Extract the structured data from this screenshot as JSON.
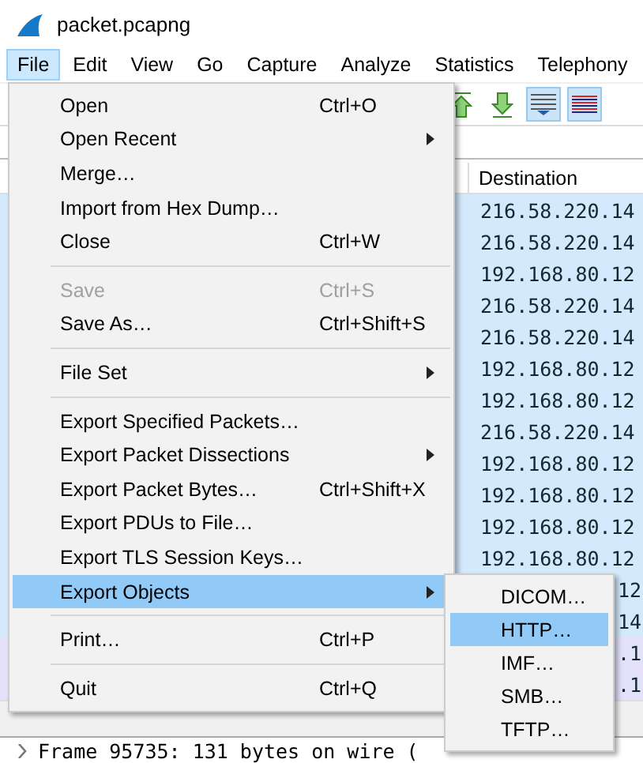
{
  "window": {
    "title": "packet.pcapng"
  },
  "menubar": [
    {
      "label": "File",
      "selected": true
    },
    {
      "label": "Edit",
      "selected": false
    },
    {
      "label": "View",
      "selected": false
    },
    {
      "label": "Go",
      "selected": false
    },
    {
      "label": "Capture",
      "selected": false
    },
    {
      "label": "Analyze",
      "selected": false
    },
    {
      "label": "Statistics",
      "selected": false
    },
    {
      "label": "Telephony",
      "selected": false
    }
  ],
  "toolbar": [
    {
      "kind": "go-first",
      "pressed": false
    },
    {
      "kind": "go-last",
      "pressed": false
    },
    {
      "kind": "autoscroll",
      "pressed": true
    },
    {
      "kind": "colorize",
      "pressed": true
    }
  ],
  "packet_list": {
    "columns": [
      "Destination"
    ],
    "rows": [
      {
        "destination": "216.58.220.14",
        "color": "#d4e9fc"
      },
      {
        "destination": "216.58.220.14",
        "color": "#d4e9fc"
      },
      {
        "destination": "192.168.80.12",
        "color": "#d4e9fc"
      },
      {
        "destination": "216.58.220.14",
        "color": "#d4e9fc"
      },
      {
        "destination": "216.58.220.14",
        "color": "#d4e9fc"
      },
      {
        "destination": "192.168.80.12",
        "color": "#d4e9fc"
      },
      {
        "destination": "192.168.80.12",
        "color": "#d4e9fc"
      },
      {
        "destination": "216.58.220.14",
        "color": "#d4e9fc"
      },
      {
        "destination": "192.168.80.12",
        "color": "#d4e9fc"
      },
      {
        "destination": "192.168.80.12",
        "color": "#d4e9fc"
      },
      {
        "destination": "192.168.80.12",
        "color": "#d4e9fc"
      },
      {
        "destination": "192.168.80.12",
        "color": "#d4e9fc"
      },
      {
        "kind": "covered",
        "destination": "12",
        "color": "#d4e9fc"
      },
      {
        "kind": "covered",
        "destination": "14",
        "color": "#d4e9fc"
      },
      {
        "kind": "covered",
        "destination": ".1",
        "color": "#e4e2fa"
      },
      {
        "kind": "covered",
        "destination": ".1",
        "color": "#e4e2fa"
      }
    ]
  },
  "packet_details": [
    {
      "text": "Frame 95735: 131 bytes on wire (",
      "expanded": false
    }
  ],
  "file_menu": [
    {
      "kind": "item",
      "label": "Open",
      "shortcut": "Ctrl+O",
      "submenu": false,
      "disabled": false,
      "selected": false
    },
    {
      "kind": "item",
      "label": "Open Recent",
      "submenu": true,
      "disabled": false,
      "selected": false
    },
    {
      "kind": "item",
      "label": "Merge…",
      "submenu": false,
      "disabled": false,
      "selected": false
    },
    {
      "kind": "item",
      "label": "Import from Hex Dump…",
      "submenu": false,
      "disabled": false,
      "selected": false
    },
    {
      "kind": "item",
      "label": "Close",
      "shortcut": "Ctrl+W",
      "submenu": false,
      "disabled": false,
      "selected": false
    },
    {
      "kind": "separator"
    },
    {
      "kind": "item",
      "label": "Save",
      "shortcut": "Ctrl+S",
      "submenu": false,
      "disabled": true,
      "selected": false
    },
    {
      "kind": "item",
      "label": "Save As…",
      "shortcut": "Ctrl+Shift+S",
      "submenu": false,
      "disabled": false,
      "selected": false
    },
    {
      "kind": "separator"
    },
    {
      "kind": "item",
      "label": "File Set",
      "submenu": true,
      "disabled": false,
      "selected": false
    },
    {
      "kind": "separator"
    },
    {
      "kind": "item",
      "label": "Export Specified Packets…",
      "submenu": false,
      "disabled": false,
      "selected": false
    },
    {
      "kind": "item",
      "label": "Export Packet Dissections",
      "submenu": true,
      "disabled": false,
      "selected": false
    },
    {
      "kind": "item",
      "label": "Export Packet Bytes…",
      "shortcut": "Ctrl+Shift+X",
      "submenu": false,
      "disabled": false,
      "selected": false
    },
    {
      "kind": "item",
      "label": "Export PDUs to File…",
      "submenu": false,
      "disabled": false,
      "selected": false
    },
    {
      "kind": "item",
      "label": "Export TLS Session Keys…",
      "submenu": false,
      "disabled": false,
      "selected": false
    },
    {
      "kind": "item",
      "label": "Export Objects",
      "submenu": true,
      "disabled": false,
      "selected": true
    },
    {
      "kind": "separator"
    },
    {
      "kind": "item",
      "label": "Print…",
      "shortcut": "Ctrl+P",
      "submenu": false,
      "disabled": false,
      "selected": false
    },
    {
      "kind": "separator"
    },
    {
      "kind": "item",
      "label": "Quit",
      "shortcut": "Ctrl+Q",
      "submenu": false,
      "disabled": false,
      "selected": false
    }
  ],
  "export_objects_submenu": [
    {
      "label": "DICOM…",
      "selected": false
    },
    {
      "label": "HTTP…",
      "selected": true
    },
    {
      "label": "IMF…",
      "selected": false
    },
    {
      "label": "SMB…",
      "selected": false
    },
    {
      "label": "TFTP…",
      "selected": false
    }
  ]
}
